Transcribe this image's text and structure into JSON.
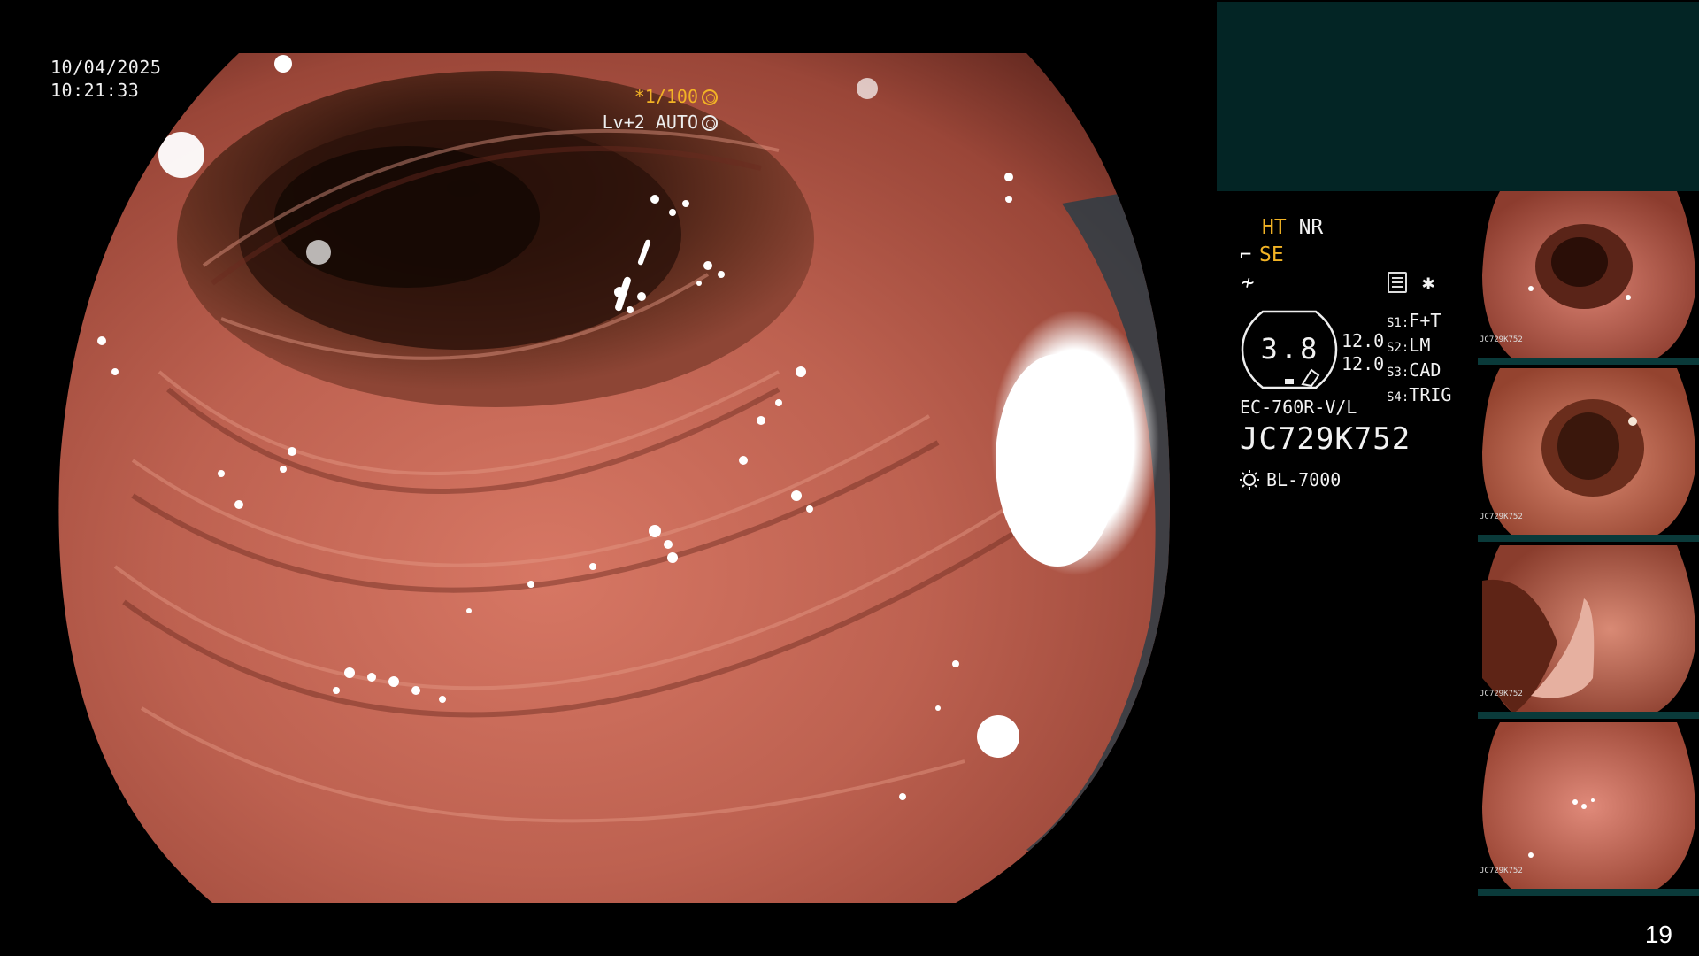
{
  "overlay": {
    "date": "10/04/2025",
    "time": "10:21:33",
    "shutter": "*1/100",
    "iris": "Lv+2 AUTO"
  },
  "modes": {
    "ht": "HT",
    "nr": "NR",
    "se": "SE"
  },
  "status": {
    "oval_value": "3.8",
    "num1": "12.0",
    "num2": "12.0",
    "switches": [
      {
        "key": "S1:",
        "value": "F+T"
      },
      {
        "key": "S2:",
        "value": "LM"
      },
      {
        "key": "S3:",
        "value": "CAD"
      },
      {
        "key": "S4:",
        "value": "TRIG"
      }
    ]
  },
  "scope": {
    "model": "EC-760R-V/L",
    "serial": "JC729K752",
    "light_source": "BL-7000"
  },
  "thumbnails": [
    {
      "name": "thumb-1",
      "label": "JC729K752"
    },
    {
      "name": "thumb-2",
      "label": "JC729K752"
    },
    {
      "name": "thumb-3",
      "label": "JC729K752"
    },
    {
      "name": "thumb-4",
      "label": "JC729K752"
    }
  ],
  "page_number": "19",
  "colors": {
    "accent_orange": "#f2b325",
    "panel_teal": "#032525",
    "tissue": "#b85a48"
  },
  "icons": [
    "shutter-ring-icon",
    "iris-ring-icon",
    "curve-icon",
    "wave-icon",
    "document-icon",
    "asterisk-icon",
    "sun-icon"
  ]
}
